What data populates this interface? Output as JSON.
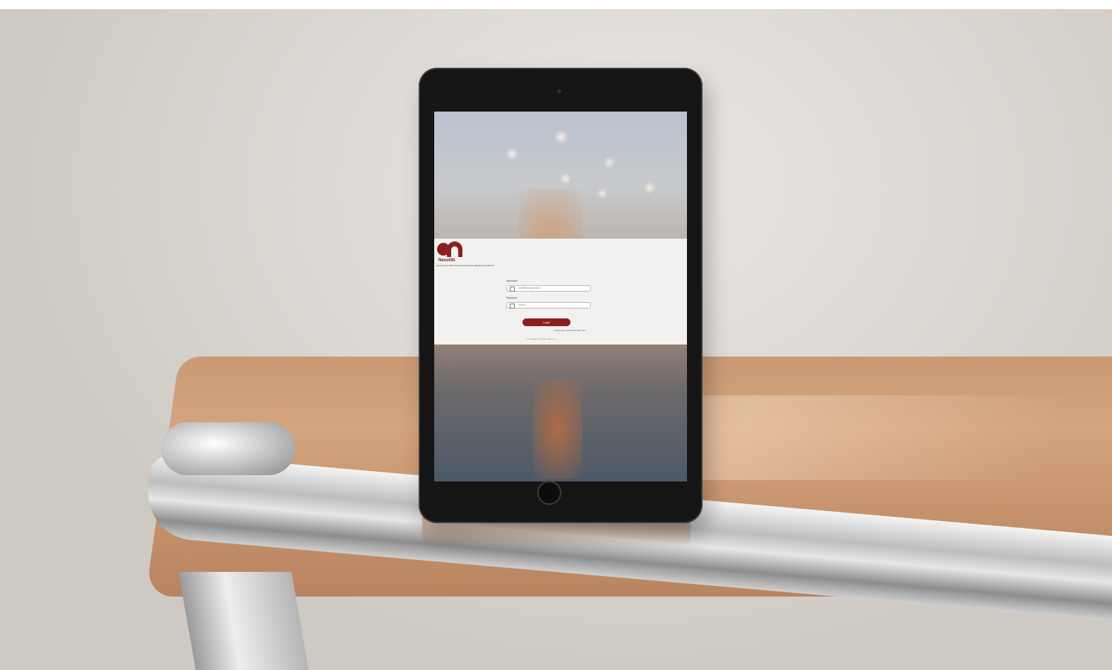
{
  "login": {
    "brand_name": "Nexolith",
    "brand_tagline": "Lorem ipsum dolor sit amet consectetur adipiscing elit sed do",
    "username_label": "Username",
    "username_value": "user@example.com",
    "password_label": "Password",
    "password_value": "••••••••",
    "login_button": "Login",
    "forgot_link": "Forgot your password? Click here",
    "footer": "© Copyright. All rights reserved"
  },
  "colors": {
    "brand": "#8c1e22",
    "panel": "#f3f1ef",
    "wall": "#dcd7d2"
  }
}
